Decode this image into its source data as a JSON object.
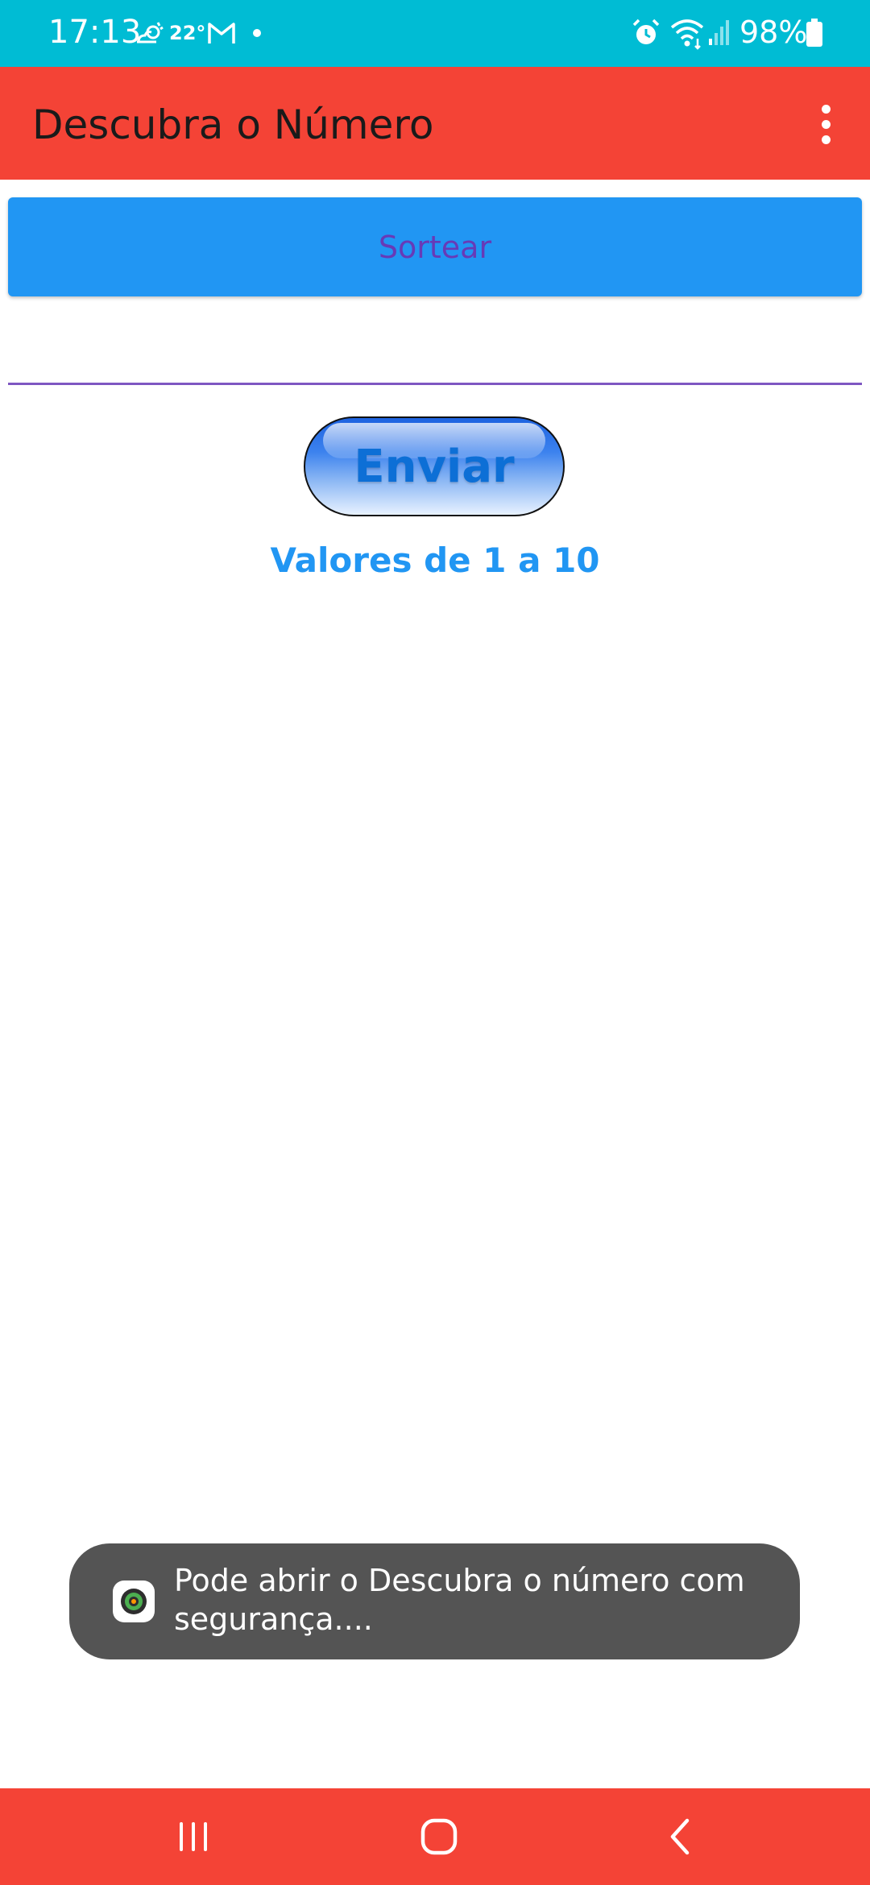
{
  "status_bar": {
    "time": "17:13",
    "temperature": "22°",
    "battery": "98%",
    "icons": [
      "weather-icon",
      "gmail-icon",
      "notification-dot",
      "alarm-icon",
      "wifi-icon",
      "signal-icon",
      "battery-icon"
    ],
    "background_color": "#00BCD4"
  },
  "app_bar": {
    "title": "Descubra o Número",
    "menu_icon": "overflow-menu-icon",
    "background_color": "#F44336"
  },
  "main": {
    "sortear_label": "Sortear",
    "number_input": {
      "value": "",
      "placeholder": ""
    },
    "enviar_label": "Enviar",
    "range_hint": "Valores de 1 a 10"
  },
  "toast": {
    "message": "Pode abrir o Descubra o número com segurança....",
    "icon": "security-app-icon"
  },
  "nav_bar": {
    "buttons": [
      "recent-apps-icon",
      "home-icon",
      "back-icon"
    ],
    "background_color": "#F44336"
  },
  "colors": {
    "accent_blue": "#2196F3",
    "accent_purple": "#673AB7",
    "toast_background": "#545454"
  }
}
